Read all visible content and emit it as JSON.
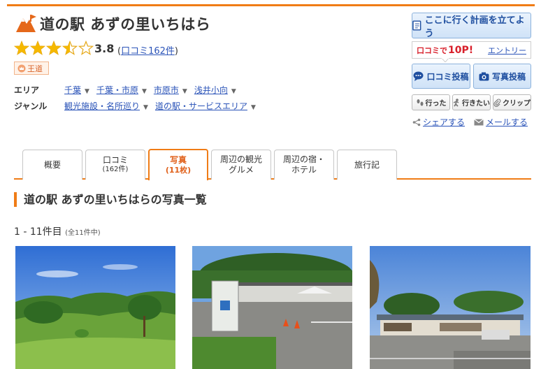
{
  "header": {
    "title": "道の駅 あずの里いちはら",
    "rating": 3.5,
    "score": "3.8",
    "review_prefix": "(",
    "review_link": "口コミ162件",
    "review_suffix": ")",
    "badge": "王道"
  },
  "info": {
    "area_label": "エリア",
    "area_links": [
      "千葉",
      "千葉・市原",
      "市原市",
      "浅井小向"
    ],
    "genre_label": "ジャンル",
    "genre_links": [
      "観光施設・名所巡り",
      "道の駅・サービスエリア"
    ]
  },
  "side": {
    "plan_button": "ここに行く計画を立てよう",
    "points_label": "口コミで",
    "points_value": "10P!",
    "entry_link": "エントリー",
    "review_post": "口コミ投稿",
    "photo_post": "写真投稿",
    "went": "行った",
    "want": "行きたい",
    "clip": "クリップ",
    "share": "シェアする",
    "mail": "メールする"
  },
  "tabs": [
    {
      "label": "概要",
      "sub": ""
    },
    {
      "label": "口コミ",
      "sub": "(162件)"
    },
    {
      "label": "写真",
      "sub": "(11枚)",
      "active": true
    },
    {
      "label": "周辺の観光",
      "sub": "グルメ"
    },
    {
      "label": "周辺の宿・",
      "sub": "ホテル"
    },
    {
      "label": "旅行記",
      "sub": ""
    }
  ],
  "section": {
    "title": "道の駅 あずの里いちはらの写真一覧",
    "count": "1 - 11件目",
    "count_total": "(全11件中)"
  },
  "colors": {
    "accent": "#f07c16",
    "link": "#2a53b8",
    "button_blue": "#1f4fa0",
    "points_red": "#d8202b"
  },
  "icons": {
    "spot": "mountain-sightseeing-icon",
    "star": "star-icon",
    "badge": "crown-icon",
    "plan": "notepad-icon",
    "review_post": "speech-bubble-icon",
    "photo_post": "camera-icon",
    "went": "footprints-icon",
    "want": "walking-person-icon",
    "clip": "paperclip-icon",
    "share": "share-icon",
    "mail": "envelope-icon"
  }
}
